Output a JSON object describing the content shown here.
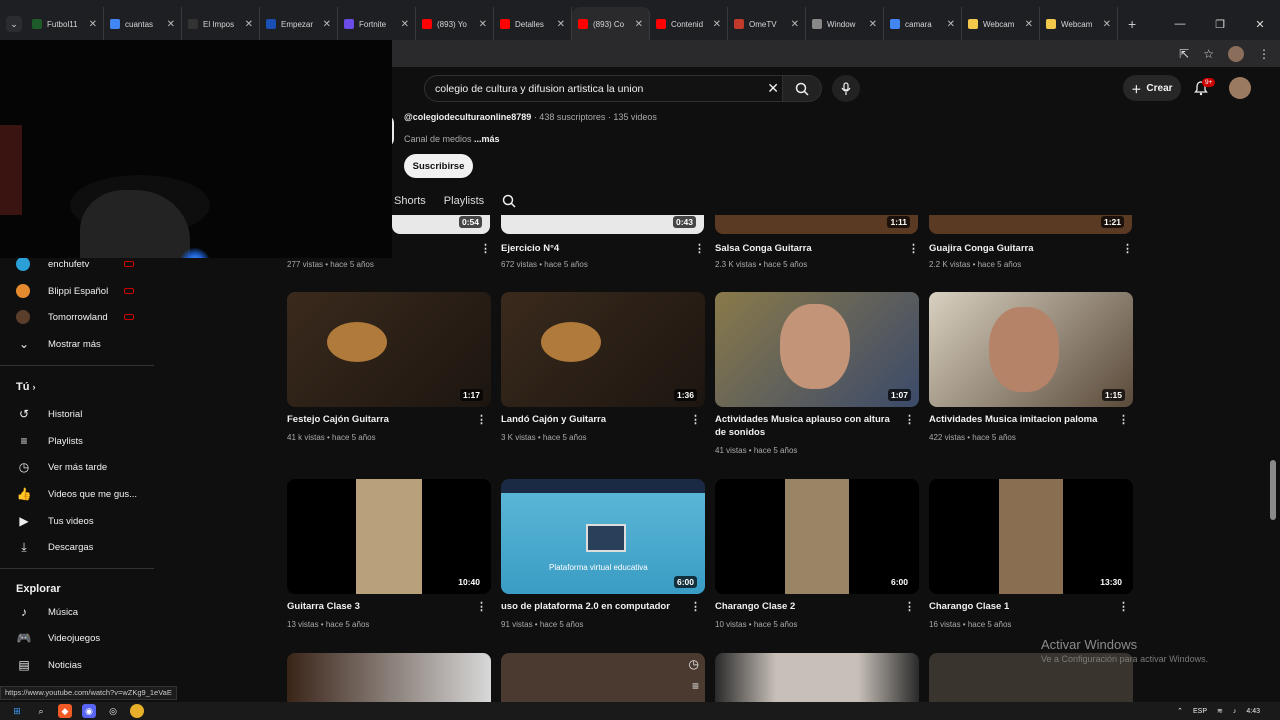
{
  "browser": {
    "tabs": [
      {
        "label": "Futbol11",
        "color": "#1d5b2a"
      },
      {
        "label": "cuantas",
        "color": "#4285f4"
      },
      {
        "label": "El Impos",
        "color": "#333333"
      },
      {
        "label": "Empezar",
        "color": "#1a4fb5"
      },
      {
        "label": "Fortnite",
        "color": "#6b4ce6"
      },
      {
        "label": "(893) Yo",
        "color": "#ff0000"
      },
      {
        "label": "Detalles",
        "color": "#ff0000"
      },
      {
        "label": "(893) Co",
        "color": "#ff0000"
      },
      {
        "label": "Contenid",
        "color": "#ff0000"
      },
      {
        "label": "OmeTV",
        "color": "#c0392b"
      },
      {
        "label": "Window",
        "color": "#888888"
      },
      {
        "label": "camara",
        "color": "#4285f4"
      },
      {
        "label": "Webcam",
        "color": "#f2c94c"
      },
      {
        "label": "Webcam",
        "color": "#f2c94c"
      }
    ],
    "new_tab": "+",
    "status_url": "https://www.youtube.com/watch?v=wZKg9_1eVaE"
  },
  "youtube": {
    "search_value": "colegio de cultura y difusion artistica la union",
    "create_label": "Crear",
    "notif_badge": "9+",
    "channel": {
      "handle": "@colegiodeculturaonline8789",
      "stats": " · 438 suscriptores · 135 videos",
      "desc": "Canal de medios ",
      "more": "...más",
      "subscribe": "Suscribirse"
    },
    "tabs": [
      "Shorts",
      "Playlists"
    ]
  },
  "sidebar": {
    "subs": [
      {
        "label": "enchufetv",
        "color": "#2aa0d6"
      },
      {
        "label": "Blippi Español",
        "color": "#e58a2e"
      },
      {
        "label": "Tomorrowland",
        "color": "#5a3d2b"
      }
    ],
    "more": "Mostrar más",
    "you_heading": "Tú",
    "you_items": [
      "Historial",
      "Playlists",
      "Ver más tarde",
      "Videos que me gus...",
      "Tus videos",
      "Descargas"
    ],
    "explore_heading": "Explorar",
    "explore_items": [
      "Música",
      "Videojuegos",
      "Noticias"
    ]
  },
  "videos_row0": [
    {
      "duration": "0:54",
      "meta": "277 vistas • hace 5 años",
      "title": ""
    },
    {
      "duration": "0:43",
      "meta": "672 vistas • hace 5 años",
      "title": "Ejercicio N°4"
    },
    {
      "duration": "1:11",
      "meta": "2.3 K vistas • hace 5 años",
      "title": "Salsa Conga Guitarra"
    },
    {
      "duration": "1:21",
      "meta": "2.2 K vistas • hace 5 años",
      "title": "Guajira Conga Guitarra"
    }
  ],
  "videos_row1": [
    {
      "title": "Festejo Cajón Guitarra",
      "duration": "1:17",
      "meta": "41 k vistas • hace 5 años"
    },
    {
      "title": "Landó Cajón y Guitarra",
      "duration": "1:36",
      "meta": "3 K vistas • hace 5 años"
    },
    {
      "title": "Actividades Musica aplauso con altura de sonidos",
      "duration": "1:07",
      "meta": "41 vistas • hace 5 años"
    },
    {
      "title": "Actividades Musica imitacion paloma",
      "duration": "1:15",
      "meta": "422 vistas • hace 5 años"
    }
  ],
  "videos_row2": [
    {
      "title": "Guitarra Clase 3",
      "duration": "10:40",
      "meta": "13 vistas • hace 5 años"
    },
    {
      "title": "uso de plataforma 2.0 en computador",
      "duration": "6:00",
      "meta": "91 vistas • hace 5 años",
      "thumb_text": "Plataforma virtual educativa"
    },
    {
      "title": "Charango Clase 2",
      "duration": "6:00",
      "meta": "10 vistas • hace 5 años"
    },
    {
      "title": "Charango Clase 1",
      "duration": "13:30",
      "meta": "16 vistas • hace 5 años"
    }
  ],
  "windows": {
    "activate_title": "Activar Windows",
    "activate_sub": "Ve a Configuración para activar Windows.",
    "lang": "ESP",
    "time": "4:43"
  }
}
